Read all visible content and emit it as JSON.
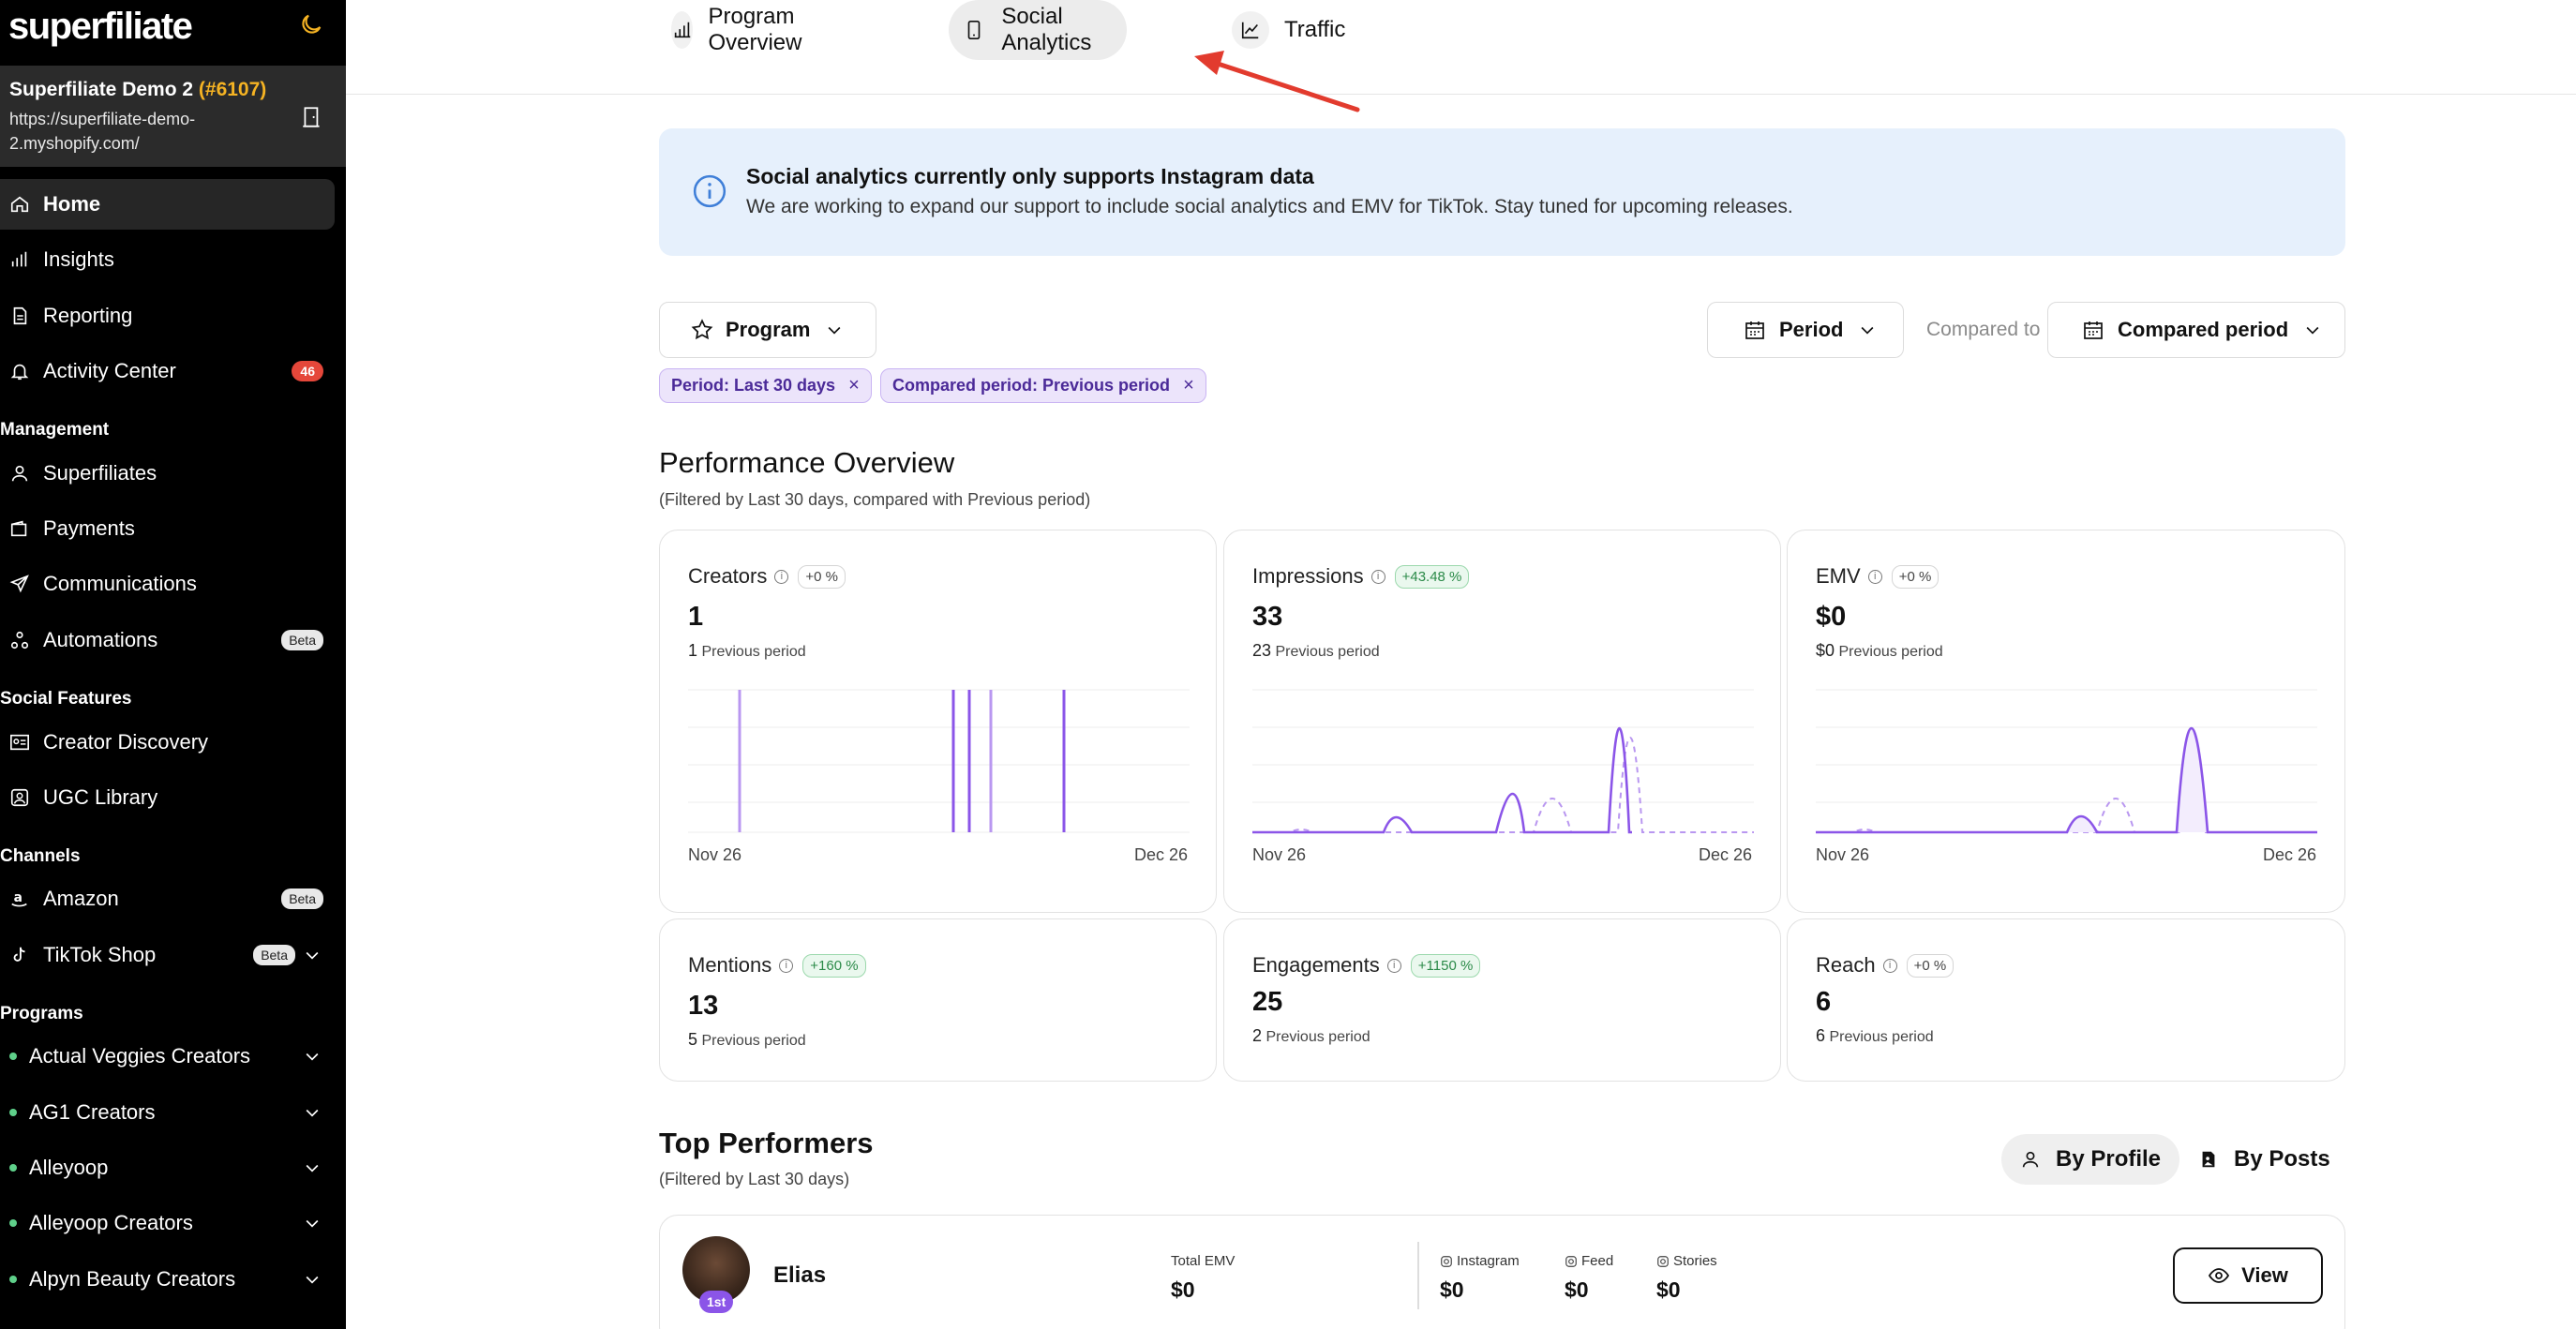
{
  "sidebar": {
    "logo": "superfiliate",
    "store": {
      "name": "Superfiliate Demo 2",
      "id": "(#6107)",
      "url": "https://superfiliate-demo-2.myshopify.com/"
    },
    "nav": [
      {
        "label": "Home",
        "icon": "home-icon",
        "active": true
      },
      {
        "label": "Insights",
        "icon": "bar-chart-icon"
      },
      {
        "label": "Reporting",
        "icon": "document-icon"
      },
      {
        "label": "Activity Center",
        "icon": "bell-icon",
        "badge": "46"
      }
    ],
    "management_title": "Management",
    "management": [
      {
        "label": "Superfiliates",
        "icon": "user-icon"
      },
      {
        "label": "Payments",
        "icon": "wallet-icon"
      },
      {
        "label": "Communications",
        "icon": "send-icon"
      },
      {
        "label": "Automations",
        "icon": "automation-icon",
        "beta": "Beta"
      }
    ],
    "social_title": "Social Features",
    "social": [
      {
        "label": "Creator Discovery",
        "icon": "contact-card-icon"
      },
      {
        "label": "UGC Library",
        "icon": "image-library-icon"
      }
    ],
    "channels_title": "Channels",
    "channels": [
      {
        "label": "Amazon",
        "icon": "amazon-icon",
        "beta": "Beta"
      },
      {
        "label": "TikTok Shop",
        "icon": "tiktok-icon",
        "beta": "Beta"
      }
    ],
    "programs_title": "Programs",
    "programs": [
      {
        "label": "Actual Veggies Creators"
      },
      {
        "label": "AG1 Creators"
      },
      {
        "label": "Alleyoop"
      },
      {
        "label": "Alleyoop Creators"
      },
      {
        "label": "Alpyn Beauty Creators"
      }
    ]
  },
  "tabs": [
    {
      "label": "Program Overview",
      "icon": "bar-chart-icon"
    },
    {
      "label": "Social Analytics",
      "icon": "phone-icon",
      "active": true
    },
    {
      "label": "Traffic",
      "icon": "trend-icon"
    }
  ],
  "banner": {
    "title": "Social analytics currently only supports Instagram data",
    "text": "We are working to expand our support to include social analytics and EMV for TikTok. Stay tuned for upcoming releases."
  },
  "filters": {
    "program": "Program",
    "period": "Period",
    "compared_to": "Compared to",
    "compared_period": "Compared period",
    "chips": [
      "Period: Last 30 days",
      "Compared period: Previous period"
    ]
  },
  "performance": {
    "title": "Performance Overview",
    "subtitle": "(Filtered by Last 30 days, compared with Previous period)",
    "prev_label": "Previous period",
    "cards": [
      {
        "title": "Creators",
        "pct": "+0 %",
        "value": "1",
        "prev": "1",
        "x_start": "Nov 26",
        "x_end": "Dec 26"
      },
      {
        "title": "Impressions",
        "pct": "+43.48 %",
        "value": "33",
        "prev": "23",
        "x_start": "Nov 26",
        "x_end": "Dec 26"
      },
      {
        "title": "EMV",
        "pct": "+0 %",
        "value": "$0",
        "prev": "$0",
        "x_start": "Nov 26",
        "x_end": "Dec 26"
      },
      {
        "title": "Mentions",
        "pct": "+160 %",
        "value": "13",
        "prev": "5"
      },
      {
        "title": "Engagements",
        "pct": "+1150 %",
        "value": "25",
        "prev": "2"
      },
      {
        "title": "Reach",
        "pct": "+0 %",
        "value": "6",
        "prev": "6"
      }
    ]
  },
  "top_performers": {
    "title": "Top Performers",
    "subtitle": "(Filtered by Last 30 days)",
    "by_profile": "By Profile",
    "by_posts": "By Posts",
    "rows": [
      {
        "name": "Elias",
        "rank": "1st",
        "total_emv_label": "Total EMV",
        "total_emv": "$0",
        "instagram_label": "Instagram",
        "instagram": "$0",
        "feed_label": "Feed",
        "feed": "$0",
        "stories_label": "Stories",
        "stories": "$0",
        "view": "View"
      }
    ]
  },
  "colors": {
    "accent": "#8b55e8",
    "banner_bg": "#e6f0fc",
    "annotation_arrow": "#e23b2e"
  }
}
